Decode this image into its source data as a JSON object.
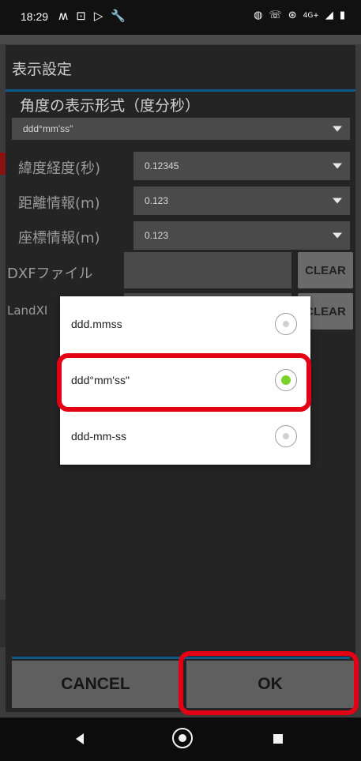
{
  "status_bar": {
    "time": "18:29",
    "left_icons": [
      "notification-m-icon",
      "screen-cast-icon",
      "play-store-icon",
      "wrench-icon"
    ],
    "right_icons": [
      "vibrate-icon",
      "4g-call-icon",
      "hotspot-icon",
      "4g-plus-icon",
      "signal-icon",
      "battery-icon"
    ]
  },
  "dialog": {
    "title": "表示設定",
    "angle_section_label": "角度の表示形式（度分秒）",
    "angle_format_value": "ddd°mm'ss\"",
    "rows": [
      {
        "label": "緯度経度(秒)",
        "value": "0.12345"
      },
      {
        "label": "距離情報(m)",
        "value": "0.123"
      },
      {
        "label": "座標情報(m)",
        "value": "0.123"
      }
    ],
    "dxf_label": "DXFファイル",
    "landxml_label": "LandXI",
    "clear_label": "CLEAR",
    "cancel_label": "CANCEL",
    "ok_label": "OK"
  },
  "popup": {
    "options": [
      {
        "label": "ddd.mmss",
        "selected": false
      },
      {
        "label": "ddd°mm'ss\"",
        "selected": true
      },
      {
        "label": "ddd-mm-ss",
        "selected": false
      }
    ]
  },
  "colors": {
    "accent_line": "#0e5a8c",
    "highlight": "#e40014",
    "radio_selected": "#7ad12a"
  },
  "nav": {
    "back_icon": "back-triangle-icon",
    "home_icon": "home-circle-icon",
    "recent_icon": "recent-apps-square-icon"
  }
}
